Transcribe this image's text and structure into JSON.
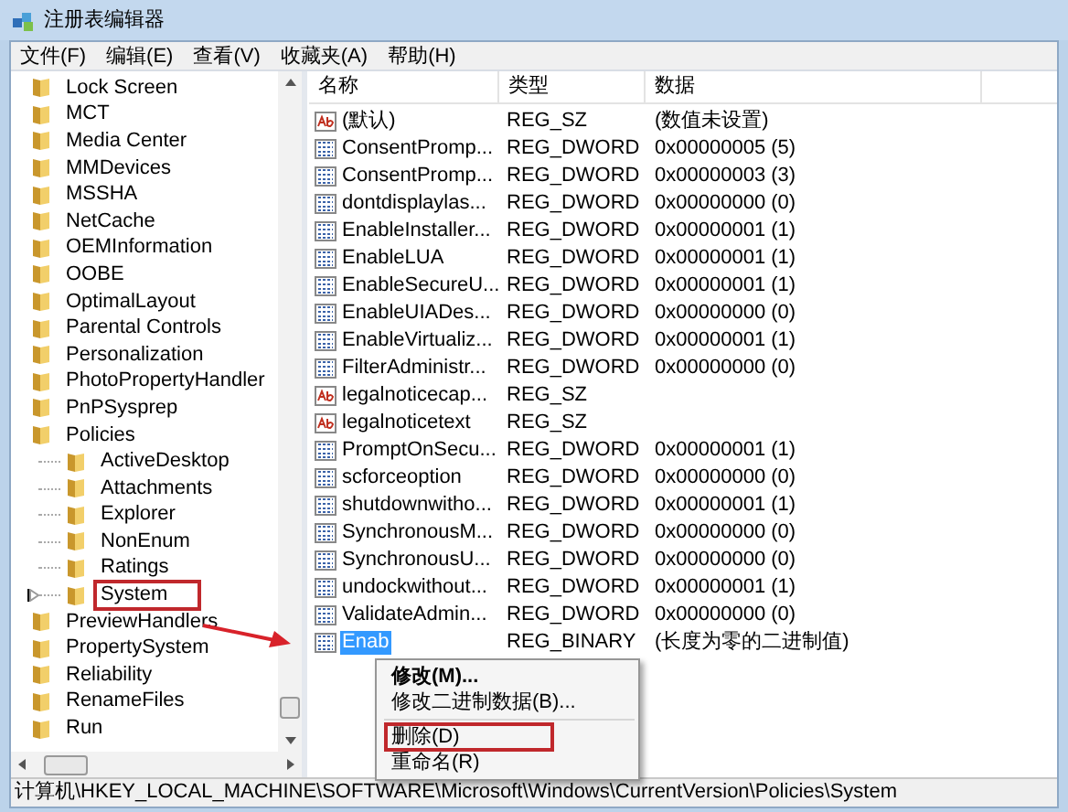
{
  "window": {
    "title": "注册表编辑器"
  },
  "menu": [
    "文件(F)",
    "编辑(E)",
    "查看(V)",
    "收藏夹(A)",
    "帮助(H)"
  ],
  "tree": [
    {
      "label": "Lock Screen",
      "expander": false,
      "annotated": false
    },
    {
      "label": "MCT",
      "expander": false,
      "annotated": false
    },
    {
      "label": "Media Center",
      "expander": false,
      "annotated": false
    },
    {
      "label": "MMDevices",
      "expander": false,
      "annotated": false
    },
    {
      "label": "MSSHA",
      "expander": false,
      "annotated": false
    },
    {
      "label": "NetCache",
      "expander": false,
      "annotated": false
    },
    {
      "label": "OEMInformation",
      "expander": false,
      "annotated": false
    },
    {
      "label": "OOBE",
      "expander": false,
      "annotated": false
    },
    {
      "label": "OptimalLayout",
      "expander": false,
      "annotated": false
    },
    {
      "label": "Parental Controls",
      "expander": false,
      "annotated": false
    },
    {
      "label": "Personalization",
      "expander": false,
      "annotated": false
    },
    {
      "label": "PhotoPropertyHandler",
      "expander": false,
      "annotated": false
    },
    {
      "label": "PnPSysprep",
      "expander": false,
      "annotated": false
    },
    {
      "label": "Policies",
      "expander": false,
      "annotated": false,
      "children": [
        {
          "label": "ActiveDesktop",
          "expander": false,
          "annotated": false
        },
        {
          "label": "Attachments",
          "expander": false,
          "annotated": false
        },
        {
          "label": "Explorer",
          "expander": false,
          "annotated": false
        },
        {
          "label": "NonEnum",
          "expander": false,
          "annotated": false
        },
        {
          "label": "Ratings",
          "expander": false,
          "annotated": false
        },
        {
          "label": "System",
          "expander": true,
          "annotated": true
        }
      ]
    },
    {
      "label": "PreviewHandlers",
      "expander": false,
      "annotated": false
    },
    {
      "label": "PropertySystem",
      "expander": false,
      "annotated": false
    },
    {
      "label": "Reliability",
      "expander": false,
      "annotated": false
    },
    {
      "label": "RenameFiles",
      "expander": false,
      "annotated": false
    },
    {
      "label": "Run",
      "expander": false,
      "annotated": false
    }
  ],
  "columns": [
    "名称",
    "类型",
    "数据"
  ],
  "rows": [
    {
      "kind": "string",
      "name": "(默认)",
      "type": "REG_SZ",
      "data": "(数值未设置)",
      "selected": false
    },
    {
      "kind": "number",
      "name": "ConsentPromp...",
      "type": "REG_DWORD",
      "data": "0x00000005 (5)",
      "selected": false
    },
    {
      "kind": "number",
      "name": "ConsentPromp...",
      "type": "REG_DWORD",
      "data": "0x00000003 (3)",
      "selected": false
    },
    {
      "kind": "number",
      "name": "dontdisplaylas...",
      "type": "REG_DWORD",
      "data": "0x00000000 (0)",
      "selected": false
    },
    {
      "kind": "number",
      "name": "EnableInstaller...",
      "type": "REG_DWORD",
      "data": "0x00000001 (1)",
      "selected": false
    },
    {
      "kind": "number",
      "name": "EnableLUA",
      "type": "REG_DWORD",
      "data": "0x00000001 (1)",
      "selected": false
    },
    {
      "kind": "number",
      "name": "EnableSecureU...",
      "type": "REG_DWORD",
      "data": "0x00000001 (1)",
      "selected": false
    },
    {
      "kind": "number",
      "name": "EnableUIADes...",
      "type": "REG_DWORD",
      "data": "0x00000000 (0)",
      "selected": false
    },
    {
      "kind": "number",
      "name": "EnableVirtualiz...",
      "type": "REG_DWORD",
      "data": "0x00000001 (1)",
      "selected": false
    },
    {
      "kind": "number",
      "name": "FilterAdministr...",
      "type": "REG_DWORD",
      "data": "0x00000000 (0)",
      "selected": false
    },
    {
      "kind": "string",
      "name": "legalnoticecap...",
      "type": "REG_SZ",
      "selected": false
    },
    {
      "kind": "string",
      "name": "legalnoticetext",
      "type": "REG_SZ",
      "selected": false
    },
    {
      "kind": "number",
      "name": "PromptOnSecu...",
      "type": "REG_DWORD",
      "data": "0x00000001 (1)",
      "selected": false
    },
    {
      "kind": "number",
      "name": "scforceoption",
      "type": "REG_DWORD",
      "data": "0x00000000 (0)",
      "selected": false
    },
    {
      "kind": "number",
      "name": "shutdownwitho...",
      "type": "REG_DWORD",
      "data": "0x00000001 (1)",
      "selected": false
    },
    {
      "kind": "number",
      "name": "SynchronousM...",
      "type": "REG_DWORD",
      "data": "0x00000000 (0)",
      "selected": false
    },
    {
      "kind": "number",
      "name": "SynchronousU...",
      "type": "REG_DWORD",
      "data": "0x00000000 (0)",
      "selected": false
    },
    {
      "kind": "number",
      "name": "undockwithout...",
      "type": "REG_DWORD",
      "data": "0x00000001 (1)",
      "selected": false
    },
    {
      "kind": "number",
      "name": "ValidateAdmin...",
      "type": "REG_DWORD",
      "data": "0x00000000 (0)",
      "selected": false
    },
    {
      "kind": "number",
      "name": "Enab",
      "type": "REG_BINARY",
      "data": "(长度为零的二进制值)",
      "selected": true
    }
  ],
  "context_menu": [
    {
      "kind": "item",
      "label": "修改(M)...",
      "bold": true,
      "annotated": false
    },
    {
      "kind": "item",
      "label": "修改二进制数据(B)...",
      "bold": false,
      "annotated": false
    },
    {
      "kind": "separator"
    },
    {
      "kind": "item",
      "label": "删除(D)",
      "bold": false,
      "annotated": true
    },
    {
      "kind": "item",
      "label": "重命名(R)",
      "bold": false,
      "annotated": false
    }
  ],
  "status_bar": "计算机\\HKEY_LOCAL_MACHINE\\SOFTWARE\\Microsoft\\Windows\\CurrentVersion\\Policies\\System"
}
